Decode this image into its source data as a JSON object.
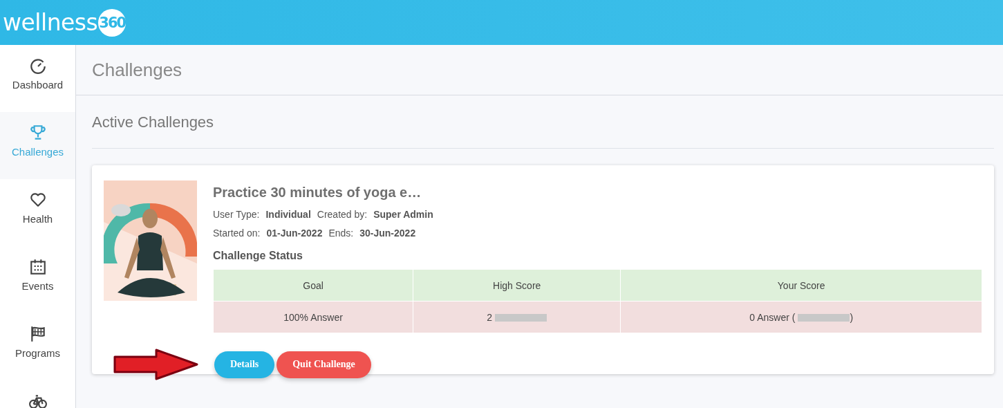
{
  "header": {
    "logo_word": "wellness",
    "logo_badge": "360"
  },
  "sidebar": {
    "items": [
      {
        "kind": "gauge",
        "label": "Dashboard",
        "selected": false
      },
      {
        "kind": "trophy",
        "label": "Challenges",
        "selected": true
      },
      {
        "kind": "heart",
        "label": "Health",
        "selected": false
      },
      {
        "kind": "calendar",
        "label": "Events",
        "selected": false
      },
      {
        "kind": "flag",
        "label": "Programs",
        "selected": false
      },
      {
        "kind": "bicycle",
        "selected": false
      }
    ]
  },
  "page_title": "Challenges",
  "section_title": "Active Challenges",
  "challenge": {
    "picture": {
      "kind": "picture"
    },
    "title": "Practice 30 minutes of yoga e…",
    "meta": [
      [
        {
          "label": "User Type:",
          "value": "Individual"
        },
        {
          "label": "Created by:",
          "value": "Super Admin"
        }
      ],
      [
        {
          "label": "Started on:",
          "value": "01-Jun-2022"
        },
        {
          "label": "Ends:",
          "value": "30-Jun-2022"
        }
      ]
    ],
    "status_title": "Challenge Status",
    "table": {
      "columns": [
        "Goal",
        "High Score",
        "Your Score"
      ],
      "row": [
        {
          "before": "100% Answer",
          "redacted": false
        },
        {
          "before": "2",
          "redacted": true
        },
        {
          "before": "0 Answer (",
          "redacted": true,
          "after": ")"
        }
      ]
    },
    "buttons": [
      {
        "label": "Details",
        "kind": "primary"
      },
      {
        "label": "Quit Challenge",
        "kind": "danger"
      }
    ]
  }
}
